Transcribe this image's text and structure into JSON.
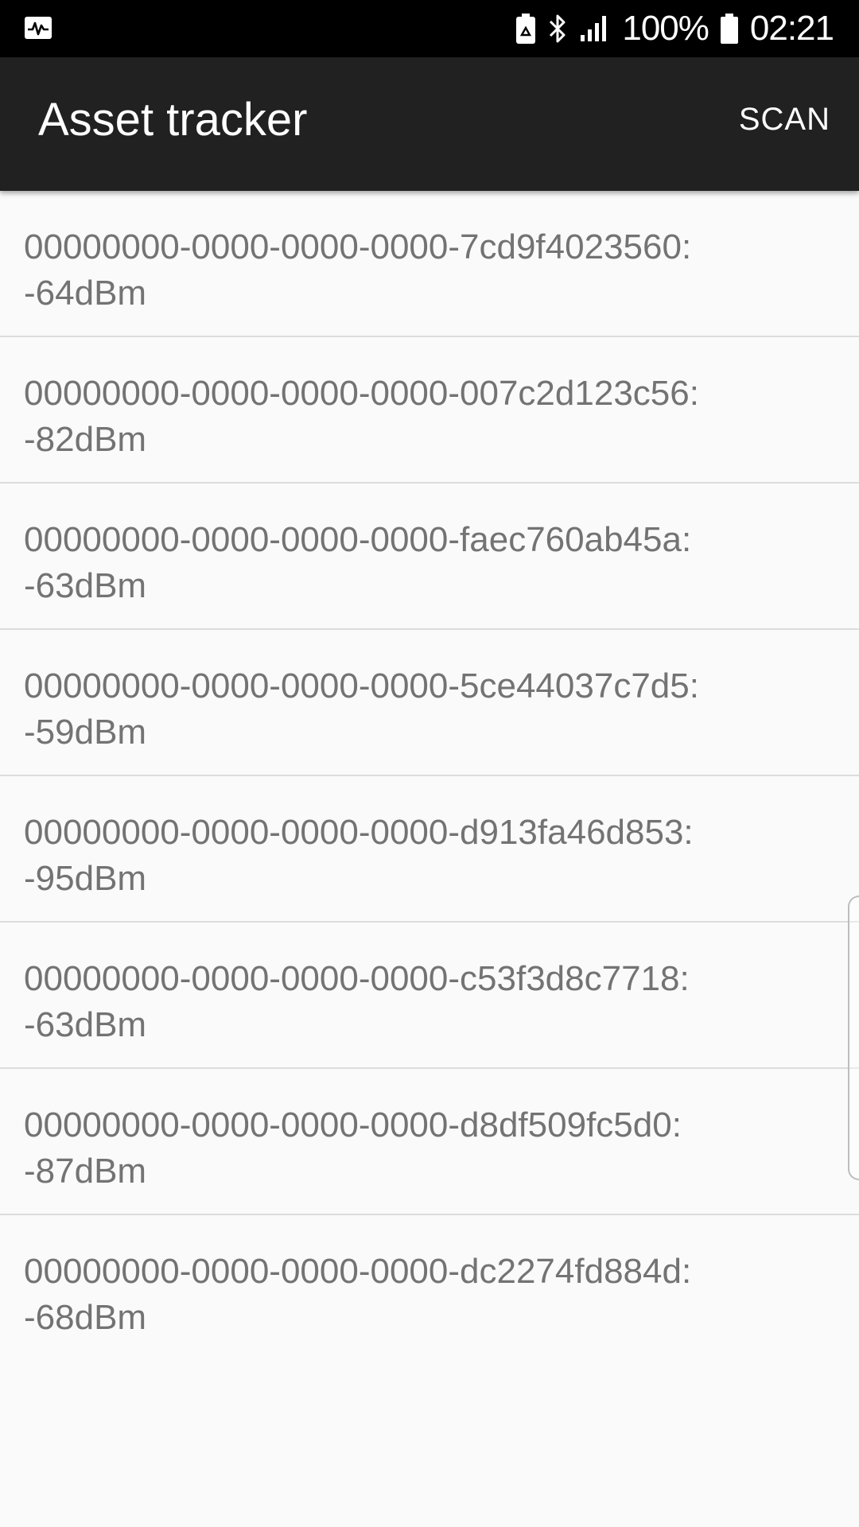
{
  "status_bar": {
    "left_icon": "activity-monitor-icon",
    "icons": [
      "battery-saver-icon",
      "bluetooth-icon",
      "signal-icon"
    ],
    "battery_percent": "100%",
    "time": "02:21"
  },
  "app_bar": {
    "title": "Asset tracker",
    "scan_label": "SCAN"
  },
  "devices": [
    {
      "uuid": "00000000-0000-0000-0000-7cd9f4023560:",
      "rssi": "-64dBm"
    },
    {
      "uuid": "00000000-0000-0000-0000-007c2d123c56:",
      "rssi": "-82dBm"
    },
    {
      "uuid": "00000000-0000-0000-0000-faec760ab45a:",
      "rssi": "-63dBm"
    },
    {
      "uuid": "00000000-0000-0000-0000-5ce44037c7d5:",
      "rssi": "-59dBm"
    },
    {
      "uuid": "00000000-0000-0000-0000-d913fa46d853:",
      "rssi": "-95dBm"
    },
    {
      "uuid": "00000000-0000-0000-0000-c53f3d8c7718:",
      "rssi": "-63dBm"
    },
    {
      "uuid": "00000000-0000-0000-0000-d8df509fc5d0:",
      "rssi": "-87dBm"
    },
    {
      "uuid": "00000000-0000-0000-0000-dc2274fd884d:",
      "rssi": "-68dBm"
    }
  ],
  "colors": {
    "status_bar_bg": "#000000",
    "app_bar_bg": "#212121",
    "list_bg": "#fafafa",
    "list_text": "#737373",
    "divider": "#dcdcdc"
  }
}
